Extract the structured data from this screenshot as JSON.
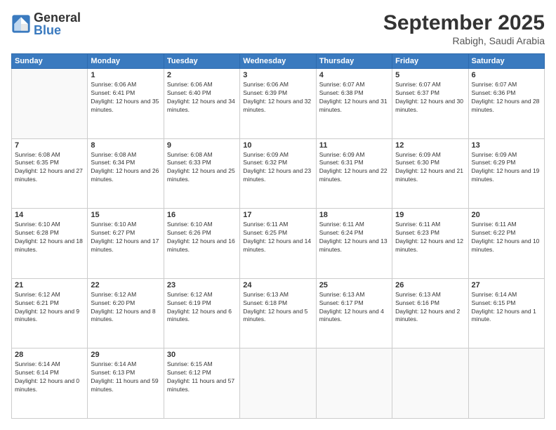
{
  "logo": {
    "line1": "General",
    "line2": "Blue"
  },
  "header": {
    "month": "September 2025",
    "location": "Rabigh, Saudi Arabia"
  },
  "weekdays": [
    "Sunday",
    "Monday",
    "Tuesday",
    "Wednesday",
    "Thursday",
    "Friday",
    "Saturday"
  ],
  "weeks": [
    [
      {
        "day": "",
        "sunrise": "",
        "sunset": "",
        "daylight": ""
      },
      {
        "day": "1",
        "sunrise": "Sunrise: 6:06 AM",
        "sunset": "Sunset: 6:41 PM",
        "daylight": "Daylight: 12 hours and 35 minutes."
      },
      {
        "day": "2",
        "sunrise": "Sunrise: 6:06 AM",
        "sunset": "Sunset: 6:40 PM",
        "daylight": "Daylight: 12 hours and 34 minutes."
      },
      {
        "day": "3",
        "sunrise": "Sunrise: 6:06 AM",
        "sunset": "Sunset: 6:39 PM",
        "daylight": "Daylight: 12 hours and 32 minutes."
      },
      {
        "day": "4",
        "sunrise": "Sunrise: 6:07 AM",
        "sunset": "Sunset: 6:38 PM",
        "daylight": "Daylight: 12 hours and 31 minutes."
      },
      {
        "day": "5",
        "sunrise": "Sunrise: 6:07 AM",
        "sunset": "Sunset: 6:37 PM",
        "daylight": "Daylight: 12 hours and 30 minutes."
      },
      {
        "day": "6",
        "sunrise": "Sunrise: 6:07 AM",
        "sunset": "Sunset: 6:36 PM",
        "daylight": "Daylight: 12 hours and 28 minutes."
      }
    ],
    [
      {
        "day": "7",
        "sunrise": "Sunrise: 6:08 AM",
        "sunset": "Sunset: 6:35 PM",
        "daylight": "Daylight: 12 hours and 27 minutes."
      },
      {
        "day": "8",
        "sunrise": "Sunrise: 6:08 AM",
        "sunset": "Sunset: 6:34 PM",
        "daylight": "Daylight: 12 hours and 26 minutes."
      },
      {
        "day": "9",
        "sunrise": "Sunrise: 6:08 AM",
        "sunset": "Sunset: 6:33 PM",
        "daylight": "Daylight: 12 hours and 25 minutes."
      },
      {
        "day": "10",
        "sunrise": "Sunrise: 6:09 AM",
        "sunset": "Sunset: 6:32 PM",
        "daylight": "Daylight: 12 hours and 23 minutes."
      },
      {
        "day": "11",
        "sunrise": "Sunrise: 6:09 AM",
        "sunset": "Sunset: 6:31 PM",
        "daylight": "Daylight: 12 hours and 22 minutes."
      },
      {
        "day": "12",
        "sunrise": "Sunrise: 6:09 AM",
        "sunset": "Sunset: 6:30 PM",
        "daylight": "Daylight: 12 hours and 21 minutes."
      },
      {
        "day": "13",
        "sunrise": "Sunrise: 6:09 AM",
        "sunset": "Sunset: 6:29 PM",
        "daylight": "Daylight: 12 hours and 19 minutes."
      }
    ],
    [
      {
        "day": "14",
        "sunrise": "Sunrise: 6:10 AM",
        "sunset": "Sunset: 6:28 PM",
        "daylight": "Daylight: 12 hours and 18 minutes."
      },
      {
        "day": "15",
        "sunrise": "Sunrise: 6:10 AM",
        "sunset": "Sunset: 6:27 PM",
        "daylight": "Daylight: 12 hours and 17 minutes."
      },
      {
        "day": "16",
        "sunrise": "Sunrise: 6:10 AM",
        "sunset": "Sunset: 6:26 PM",
        "daylight": "Daylight: 12 hours and 16 minutes."
      },
      {
        "day": "17",
        "sunrise": "Sunrise: 6:11 AM",
        "sunset": "Sunset: 6:25 PM",
        "daylight": "Daylight: 12 hours and 14 minutes."
      },
      {
        "day": "18",
        "sunrise": "Sunrise: 6:11 AM",
        "sunset": "Sunset: 6:24 PM",
        "daylight": "Daylight: 12 hours and 13 minutes."
      },
      {
        "day": "19",
        "sunrise": "Sunrise: 6:11 AM",
        "sunset": "Sunset: 6:23 PM",
        "daylight": "Daylight: 12 hours and 12 minutes."
      },
      {
        "day": "20",
        "sunrise": "Sunrise: 6:11 AM",
        "sunset": "Sunset: 6:22 PM",
        "daylight": "Daylight: 12 hours and 10 minutes."
      }
    ],
    [
      {
        "day": "21",
        "sunrise": "Sunrise: 6:12 AM",
        "sunset": "Sunset: 6:21 PM",
        "daylight": "Daylight: 12 hours and 9 minutes."
      },
      {
        "day": "22",
        "sunrise": "Sunrise: 6:12 AM",
        "sunset": "Sunset: 6:20 PM",
        "daylight": "Daylight: 12 hours and 8 minutes."
      },
      {
        "day": "23",
        "sunrise": "Sunrise: 6:12 AM",
        "sunset": "Sunset: 6:19 PM",
        "daylight": "Daylight: 12 hours and 6 minutes."
      },
      {
        "day": "24",
        "sunrise": "Sunrise: 6:13 AM",
        "sunset": "Sunset: 6:18 PM",
        "daylight": "Daylight: 12 hours and 5 minutes."
      },
      {
        "day": "25",
        "sunrise": "Sunrise: 6:13 AM",
        "sunset": "Sunset: 6:17 PM",
        "daylight": "Daylight: 12 hours and 4 minutes."
      },
      {
        "day": "26",
        "sunrise": "Sunrise: 6:13 AM",
        "sunset": "Sunset: 6:16 PM",
        "daylight": "Daylight: 12 hours and 2 minutes."
      },
      {
        "day": "27",
        "sunrise": "Sunrise: 6:14 AM",
        "sunset": "Sunset: 6:15 PM",
        "daylight": "Daylight: 12 hours and 1 minute."
      }
    ],
    [
      {
        "day": "28",
        "sunrise": "Sunrise: 6:14 AM",
        "sunset": "Sunset: 6:14 PM",
        "daylight": "Daylight: 12 hours and 0 minutes."
      },
      {
        "day": "29",
        "sunrise": "Sunrise: 6:14 AM",
        "sunset": "Sunset: 6:13 PM",
        "daylight": "Daylight: 11 hours and 59 minutes."
      },
      {
        "day": "30",
        "sunrise": "Sunrise: 6:15 AM",
        "sunset": "Sunset: 6:12 PM",
        "daylight": "Daylight: 11 hours and 57 minutes."
      },
      {
        "day": "",
        "sunrise": "",
        "sunset": "",
        "daylight": ""
      },
      {
        "day": "",
        "sunrise": "",
        "sunset": "",
        "daylight": ""
      },
      {
        "day": "",
        "sunrise": "",
        "sunset": "",
        "daylight": ""
      },
      {
        "day": "",
        "sunrise": "",
        "sunset": "",
        "daylight": ""
      }
    ]
  ]
}
